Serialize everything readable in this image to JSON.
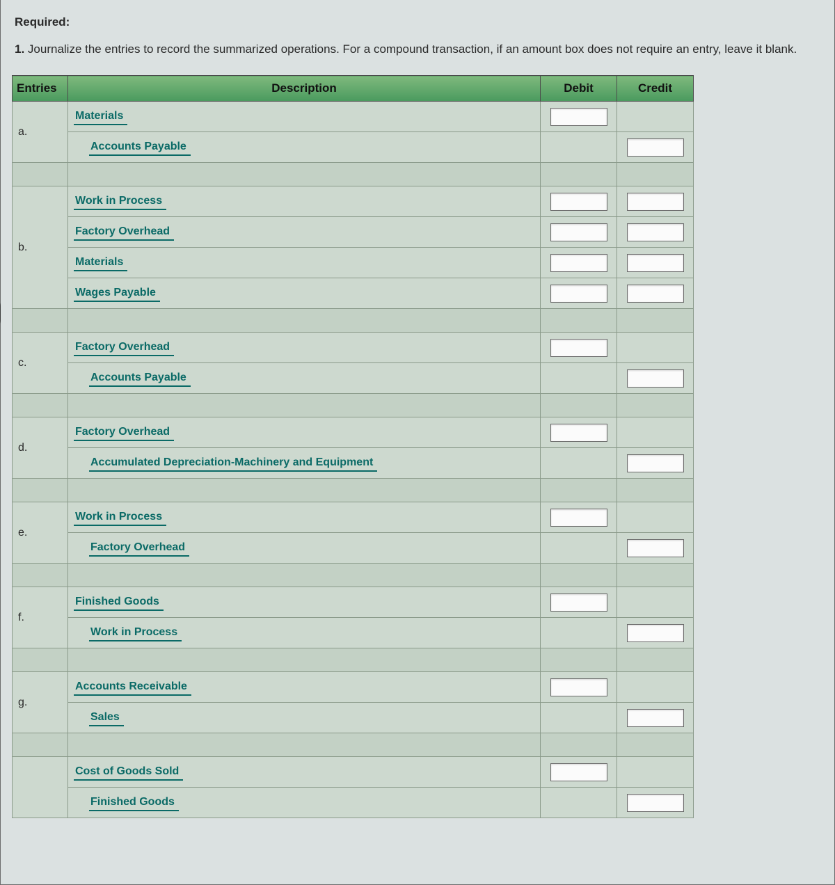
{
  "instructions": {
    "required_label": "Required:",
    "number": "1.",
    "text": "Journalize the entries to record the summarized operations. For a compound transaction, if an amount box does not require an entry, leave it blank."
  },
  "headers": {
    "entries": "Entries",
    "description": "Description",
    "debit": "Debit",
    "credit": "Credit"
  },
  "entries": [
    {
      "label": "a.",
      "lines": [
        {
          "account": "Materials",
          "indent": 1,
          "debit": true,
          "credit": false
        },
        {
          "account": "Accounts Payable",
          "indent": 2,
          "debit": false,
          "credit": true
        }
      ]
    },
    {
      "label": "b.",
      "lines": [
        {
          "account": "Work in Process",
          "indent": 1,
          "debit": true,
          "credit": true
        },
        {
          "account": "Factory Overhead",
          "indent": 1,
          "debit": true,
          "credit": true
        },
        {
          "account": "Materials",
          "indent": 1,
          "debit": true,
          "credit": true
        },
        {
          "account": "Wages Payable",
          "indent": 1,
          "debit": true,
          "credit": true
        }
      ]
    },
    {
      "label": "c.",
      "lines": [
        {
          "account": "Factory Overhead",
          "indent": 1,
          "debit": true,
          "credit": false
        },
        {
          "account": "Accounts Payable",
          "indent": 2,
          "debit": false,
          "credit": true
        }
      ]
    },
    {
      "label": "d.",
      "lines": [
        {
          "account": "Factory Overhead",
          "indent": 1,
          "debit": true,
          "credit": false
        },
        {
          "account": "Accumulated Depreciation-Machinery and Equipment",
          "indent": 2,
          "debit": false,
          "credit": true
        }
      ]
    },
    {
      "label": "e.",
      "lines": [
        {
          "account": "Work in Process",
          "indent": 1,
          "debit": true,
          "credit": false
        },
        {
          "account": "Factory Overhead",
          "indent": 2,
          "debit": false,
          "credit": true
        }
      ]
    },
    {
      "label": "f.",
      "lines": [
        {
          "account": "Finished Goods",
          "indent": 1,
          "debit": true,
          "credit": false
        },
        {
          "account": "Work in Process",
          "indent": 2,
          "debit": false,
          "credit": true
        }
      ]
    },
    {
      "label": "g.",
      "lines": [
        {
          "account": "Accounts Receivable",
          "indent": 1,
          "debit": true,
          "credit": false
        },
        {
          "account": "Sales",
          "indent": 2,
          "debit": false,
          "credit": true
        }
      ]
    },
    {
      "label": "",
      "lines": [
        {
          "account": "Cost of Goods Sold",
          "indent": 1,
          "debit": true,
          "credit": false
        },
        {
          "account": "Finished Goods",
          "indent": 2,
          "debit": false,
          "credit": true
        }
      ]
    }
  ]
}
